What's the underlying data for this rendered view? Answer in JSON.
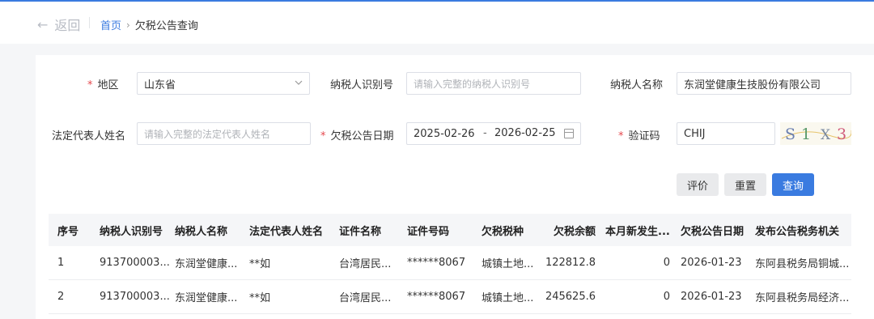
{
  "nav": {
    "back_label": "返回",
    "breadcrumb_home": "首页",
    "breadcrumb_current": "欠税公告查询"
  },
  "form": {
    "region_label": "地区",
    "region_value": "山东省",
    "taxpayer_id_label": "纳税人识别号",
    "taxpayer_id_placeholder": "请输入完整的纳税人识别号",
    "taxpayer_name_label": "纳税人名称",
    "taxpayer_name_value": "东润堂健康生技股份有限公司",
    "legal_rep_label": "法定代表人姓名",
    "legal_rep_placeholder": "请输入完整的法定代表人姓名",
    "notice_date_label": "欠税公告日期",
    "date_start": "2025-02-26",
    "date_sep": "-",
    "date_end": "2026-02-25",
    "captcha_label": "验证码",
    "captcha_value": "CHIJ",
    "captcha_image_text": "S1 X3"
  },
  "buttons": {
    "evaluate": "评价",
    "reset": "重置",
    "query": "查询"
  },
  "table": {
    "headers": [
      "序号",
      "纳税人识别号",
      "纳税人名称",
      "法定代表人姓名",
      "证件名称",
      "证件号码",
      "欠税税种",
      "欠税余额",
      "本月新发生...",
      "欠税公告日期",
      "发布公告税务机关"
    ],
    "rows": [
      [
        "1",
        "913700003...",
        "东润堂健康...",
        "**如",
        "台湾居民...",
        "******8067",
        "城镇土地...",
        "122812.8",
        "0",
        "2026-01-23",
        "东阿县税务局铜城..."
      ],
      [
        "2",
        "913700003...",
        "东润堂健康...",
        "**如",
        "台湾居民...",
        "******8067",
        "城镇土地...",
        "245625.6",
        "0",
        "2026-01-23",
        "东阿县税务局经济..."
      ]
    ]
  },
  "colors": {
    "accent": "#3a7be0",
    "required": "#e5484d"
  }
}
